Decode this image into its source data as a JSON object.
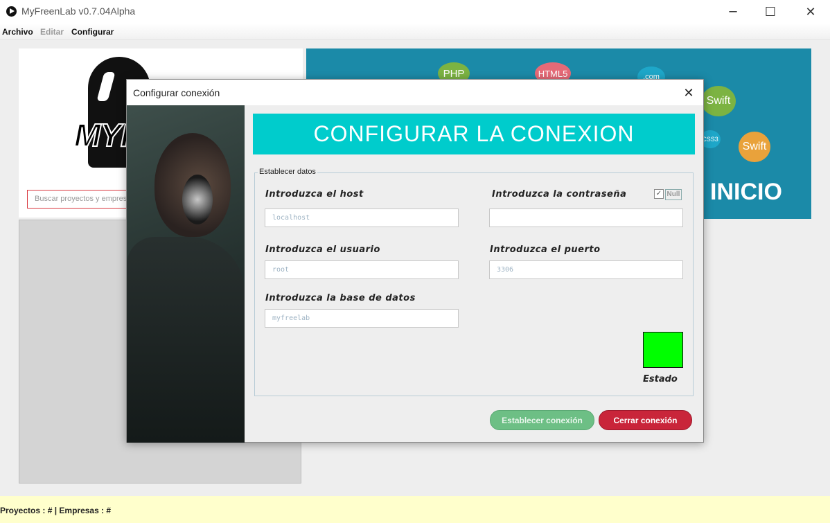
{
  "window": {
    "title": "MyFreenLab v0.7.04Alpha",
    "minimize_glyph": "─",
    "maximize_glyph": "☐",
    "close_glyph": "✕"
  },
  "menu": {
    "items": [
      {
        "label": "Archivo",
        "enabled": true
      },
      {
        "label": "Editar",
        "enabled": false
      },
      {
        "label": "Configurar",
        "enabled": true
      }
    ]
  },
  "sidebar": {
    "logo_text": "MYF",
    "search_placeholder": "Buscar proyectos y empresas"
  },
  "banner": {
    "text": "INICIO",
    "bubbles": [
      "PHP",
      "HTML5",
      ".com",
      "Swift",
      "Swift",
      "CSS3"
    ]
  },
  "dialog": {
    "title": "Configurar conexión",
    "close_glyph": "✕",
    "header": "CONFIGURAR LA CONEXION",
    "fieldset_legend": "Establecer datos",
    "fields": {
      "host": {
        "label": "Introduzca el host",
        "value": "localhost"
      },
      "password": {
        "label": "Introduzca la contraseña",
        "value": ""
      },
      "user": {
        "label": "Introduzca el usuario",
        "value": "root"
      },
      "port": {
        "label": "Introduzca el puerto",
        "value": "3306"
      },
      "database": {
        "label": "Introduzca la base de datos",
        "value": "myfreelab"
      }
    },
    "null_checkbox": {
      "checked": true,
      "check_glyph": "✓",
      "label": "Null"
    },
    "status": {
      "label": "Estado",
      "color": "#00ff00"
    },
    "buttons": {
      "connect": "Establecer conexión",
      "close": "Cerrar conexión"
    }
  },
  "statusbar": {
    "text": "Proyectos : #  |  Empresas : #"
  },
  "colors": {
    "accent_cyan": "#00cccc",
    "banner_blue": "#1b8aa8",
    "status_yellow": "#ffffcc",
    "close_red": "#c9253a",
    "connect_green": "#6dbf85"
  }
}
